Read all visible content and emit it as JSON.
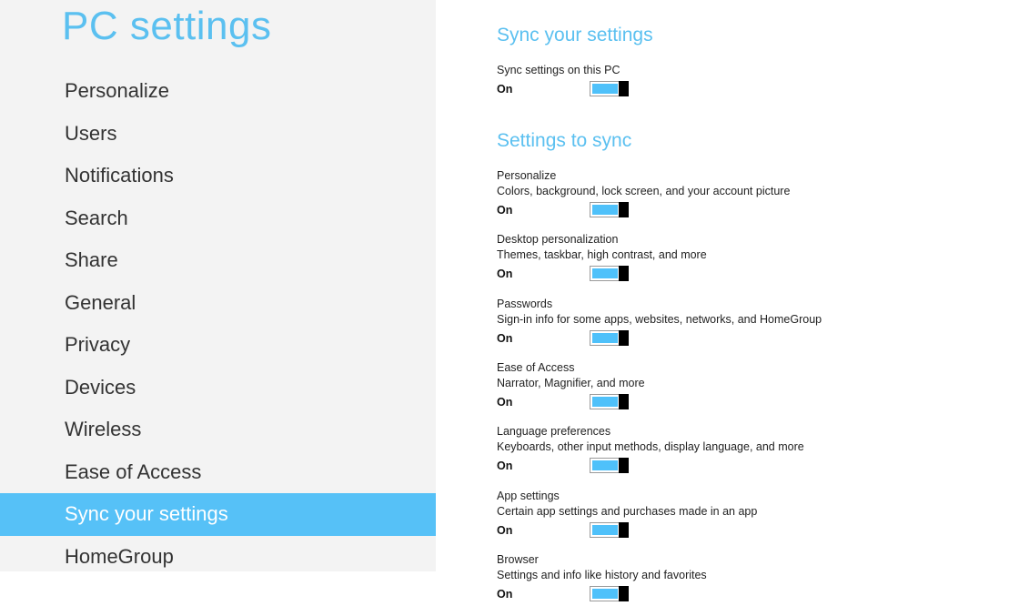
{
  "app_title": "PC settings",
  "colors": {
    "accent": "#5bc0f0",
    "selected_bg": "#56c1f7",
    "toggle_fill": "#4fc1fa",
    "sidebar_bg": "#f3f3f3"
  },
  "sidebar": {
    "items": [
      {
        "label": "Personalize",
        "selected": false
      },
      {
        "label": "Users",
        "selected": false
      },
      {
        "label": "Notifications",
        "selected": false
      },
      {
        "label": "Search",
        "selected": false
      },
      {
        "label": "Share",
        "selected": false
      },
      {
        "label": "General",
        "selected": false
      },
      {
        "label": "Privacy",
        "selected": false
      },
      {
        "label": "Devices",
        "selected": false
      },
      {
        "label": "Wireless",
        "selected": false
      },
      {
        "label": "Ease of Access",
        "selected": false
      },
      {
        "label": "Sync your settings",
        "selected": true
      },
      {
        "label": "HomeGroup",
        "selected": false
      }
    ]
  },
  "main": {
    "section1": {
      "title": "Sync your settings",
      "master": {
        "label": "Sync settings on this PC",
        "state": "On",
        "on": true
      }
    },
    "section2": {
      "title": "Settings to sync",
      "items": [
        {
          "label": "Personalize",
          "desc": "Colors, background, lock screen, and your account picture",
          "state": "On",
          "on": true
        },
        {
          "label": "Desktop personalization",
          "desc": "Themes, taskbar, high contrast, and more",
          "state": "On",
          "on": true
        },
        {
          "label": "Passwords",
          "desc": "Sign-in info for some apps, websites, networks, and HomeGroup",
          "state": "On",
          "on": true
        },
        {
          "label": "Ease of Access",
          "desc": "Narrator, Magnifier, and more",
          "state": "On",
          "on": true
        },
        {
          "label": "Language preferences",
          "desc": "Keyboards, other input methods, display language, and more",
          "state": "On",
          "on": true
        },
        {
          "label": "App settings",
          "desc": "Certain app settings and purchases made in an app",
          "state": "On",
          "on": true
        },
        {
          "label": "Browser",
          "desc": "Settings and info like history and favorites",
          "state": "On",
          "on": true
        }
      ]
    }
  }
}
